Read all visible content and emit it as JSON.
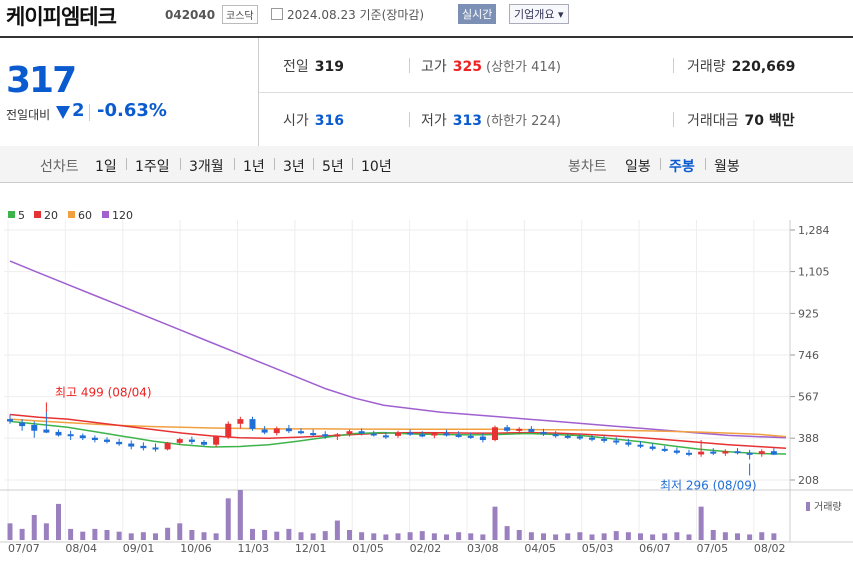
{
  "header": {
    "stock_name": "케이피엠테크",
    "stock_code": "042040",
    "market": "코스닥",
    "date_text": "2024.08.23 기준(장마감)",
    "realtime_button": "실시간",
    "company_info_button": "기업개요"
  },
  "price": {
    "current": "317",
    "change_label": "전일대비",
    "change_value": "2",
    "change_pct": "-0.63%"
  },
  "stats": {
    "prev_close": {
      "label": "전일",
      "value": "319"
    },
    "high": {
      "label": "고가",
      "value": "325",
      "sub": "(상한가 414)"
    },
    "volume": {
      "label": "거래량",
      "value": "220,669"
    },
    "open": {
      "label": "시가",
      "value": "316"
    },
    "low": {
      "label": "저가",
      "value": "313",
      "sub": "(하한가 224)"
    },
    "amount": {
      "label": "거래대금",
      "value": "70 백만"
    }
  },
  "tabs": {
    "line_label": "선차트",
    "periods": [
      "1일",
      "1주일",
      "3개월",
      "1년",
      "3년",
      "5년",
      "10년"
    ],
    "candle_label": "봉차트",
    "candle": [
      "일봉",
      "주봉",
      "월봉"
    ],
    "active_candle": "주봉"
  },
  "chart_data": {
    "type": "candlestick",
    "legend": [
      {
        "name": "5",
        "color": "#3cb44b"
      },
      {
        "name": "20",
        "color": "#e63232"
      },
      {
        "name": "60",
        "color": "#f0a040"
      },
      {
        "name": "120",
        "color": "#a060d0"
      }
    ],
    "y_ticks": [
      1284,
      1105,
      925,
      746,
      567,
      388,
      208
    ],
    "ylim": [
      208,
      1284
    ],
    "x_ticks": [
      "07/07",
      "08/04",
      "09/01",
      "10/06",
      "11/03",
      "12/01",
      "01/05",
      "02/02",
      "03/08",
      "04/05",
      "05/03",
      "06/07",
      "07/05",
      "08/02"
    ],
    "annotations": {
      "high": "최고 499 (08/04)",
      "low": "최저 296 (08/09)"
    },
    "volume_label": "거래량",
    "up_color": "#e63232",
    "down_color": "#1f6fd6",
    "ma120": [
      1150,
      1100,
      1050,
      1000,
      950,
      900,
      850,
      800,
      750,
      700,
      650,
      600,
      560,
      530,
      515,
      500,
      490,
      480,
      470,
      460,
      450,
      440,
      430,
      420,
      410,
      400,
      395,
      390
    ],
    "ma60": [
      470,
      462,
      455,
      448,
      442,
      438,
      435,
      432,
      430,
      428,
      428,
      428,
      427,
      427,
      426,
      426,
      426,
      426,
      425,
      424,
      423,
      422,
      420,
      417,
      414,
      410,
      405,
      395
    ],
    "ma20": [
      490,
      478,
      470,
      455,
      440,
      425,
      410,
      398,
      390,
      388,
      392,
      398,
      404,
      410,
      412,
      411,
      410,
      410,
      412,
      410,
      405,
      398,
      390,
      380,
      370,
      360,
      352,
      345
    ],
    "ma5": [
      460,
      448,
      435,
      415,
      395,
      375,
      360,
      350,
      352,
      360,
      375,
      392,
      408,
      412,
      406,
      404,
      402,
      404,
      408,
      404,
      398,
      385,
      372,
      355,
      340,
      330,
      322,
      320
    ],
    "candles": [
      [
        470,
        490,
        450,
        460
      ],
      [
        455,
        470,
        420,
        440
      ],
      [
        445,
        460,
        390,
        420
      ],
      [
        425,
        499,
        410,
        412
      ],
      [
        415,
        425,
        395,
        400
      ],
      [
        405,
        420,
        380,
        398
      ],
      [
        400,
        408,
        380,
        388
      ],
      [
        390,
        400,
        370,
        380
      ],
      [
        382,
        392,
        365,
        372
      ],
      [
        372,
        385,
        355,
        362
      ],
      [
        365,
        378,
        340,
        352
      ],
      [
        355,
        370,
        335,
        345
      ],
      [
        348,
        365,
        330,
        342
      ],
      [
        340,
        372,
        335,
        368
      ],
      [
        368,
        390,
        360,
        384
      ],
      [
        382,
        395,
        362,
        372
      ],
      [
        372,
        380,
        355,
        360
      ],
      [
        360,
        400,
        350,
        395
      ],
      [
        395,
        460,
        385,
        450
      ],
      [
        450,
        480,
        430,
        470
      ],
      [
        470,
        480,
        420,
        428
      ],
      [
        425,
        440,
        405,
        412
      ],
      [
        410,
        438,
        400,
        430
      ],
      [
        430,
        445,
        410,
        418
      ],
      [
        418,
        430,
        405,
        412
      ],
      [
        410,
        425,
        395,
        405
      ],
      [
        405,
        418,
        385,
        395
      ],
      [
        395,
        410,
        380,
        405
      ],
      [
        405,
        425,
        395,
        418
      ],
      [
        418,
        430,
        400,
        408
      ],
      [
        408,
        420,
        395,
        400
      ],
      [
        400,
        415,
        385,
        398
      ],
      [
        398,
        420,
        390,
        412
      ],
      [
        412,
        425,
        398,
        405
      ],
      [
        404,
        418,
        392,
        400
      ],
      [
        400,
        415,
        388,
        408
      ],
      [
        408,
        425,
        395,
        402
      ],
      [
        402,
        418,
        390,
        398
      ],
      [
        398,
        412,
        385,
        395
      ],
      [
        395,
        410,
        370,
        380
      ],
      [
        380,
        442,
        375,
        435
      ],
      [
        435,
        445,
        415,
        420
      ],
      [
        420,
        435,
        405,
        428
      ],
      [
        428,
        440,
        410,
        415
      ],
      [
        415,
        428,
        398,
        405
      ],
      [
        405,
        418,
        390,
        398
      ],
      [
        398,
        410,
        385,
        395
      ],
      [
        395,
        408,
        380,
        390
      ],
      [
        390,
        402,
        375,
        385
      ],
      [
        385,
        398,
        368,
        378
      ],
      [
        378,
        392,
        360,
        370
      ],
      [
        370,
        385,
        352,
        360
      ],
      [
        360,
        375,
        345,
        352
      ],
      [
        352,
        365,
        335,
        342
      ],
      [
        342,
        355,
        328,
        335
      ],
      [
        335,
        348,
        318,
        325
      ],
      [
        325,
        338,
        310,
        318
      ],
      [
        318,
        380,
        308,
        330
      ],
      [
        330,
        345,
        315,
        322
      ],
      [
        322,
        340,
        312,
        332
      ],
      [
        332,
        345,
        318,
        325
      ],
      [
        325,
        338,
        296,
        320
      ],
      [
        320,
        340,
        308,
        332
      ],
      [
        332,
        345,
        315,
        317
      ]
    ],
    "volumes": [
      30,
      20,
      45,
      30,
      65,
      20,
      15,
      20,
      18,
      15,
      12,
      14,
      12,
      22,
      30,
      18,
      14,
      12,
      75,
      90,
      20,
      18,
      15,
      20,
      14,
      12,
      16,
      35,
      18,
      14,
      12,
      10,
      12,
      14,
      16,
      12,
      10,
      14,
      12,
      10,
      60,
      25,
      18,
      14,
      12,
      10,
      12,
      14,
      10,
      12,
      16,
      14,
      12,
      10,
      12,
      14,
      10,
      60,
      18,
      14,
      12,
      10,
      14,
      12
    ]
  }
}
